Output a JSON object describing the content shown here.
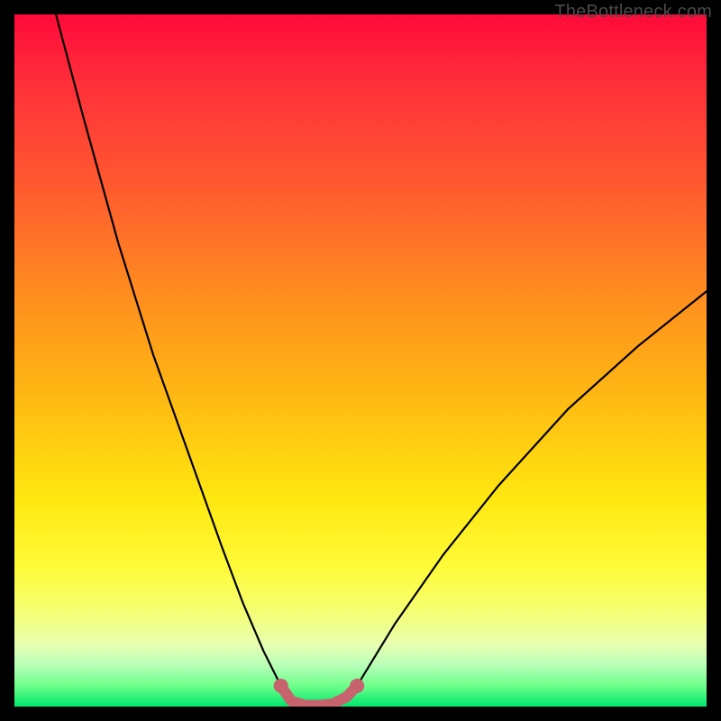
{
  "watermark": "TheBottleneck.com",
  "chart_data": {
    "type": "line",
    "title": "",
    "xlabel": "",
    "ylabel": "",
    "xlim": [
      0,
      100
    ],
    "ylim": [
      0,
      100
    ],
    "series": [
      {
        "name": "curve-left",
        "color": "#000000",
        "x": [
          6,
          10,
          15,
          20,
          25,
          30,
          33,
          36,
          38.5
        ],
        "y": [
          100,
          85,
          67,
          51,
          37,
          23,
          15,
          8,
          3
        ]
      },
      {
        "name": "valley-segment",
        "color": "#c7636f",
        "x": [
          38.5,
          40,
          42,
          44,
          46,
          48,
          49.5
        ],
        "y": [
          3,
          0.8,
          0.2,
          0.2,
          0.4,
          1.4,
          3
        ]
      },
      {
        "name": "curve-right",
        "color": "#000000",
        "x": [
          49.5,
          55,
          62,
          70,
          80,
          90,
          100
        ],
        "y": [
          3,
          12,
          22,
          32,
          43,
          52,
          60
        ]
      }
    ],
    "markers": [
      {
        "x": 38.5,
        "y": 3,
        "color": "#c7636f"
      },
      {
        "x": 49.5,
        "y": 3,
        "color": "#c7636f"
      }
    ],
    "grid": false,
    "legend": false
  }
}
